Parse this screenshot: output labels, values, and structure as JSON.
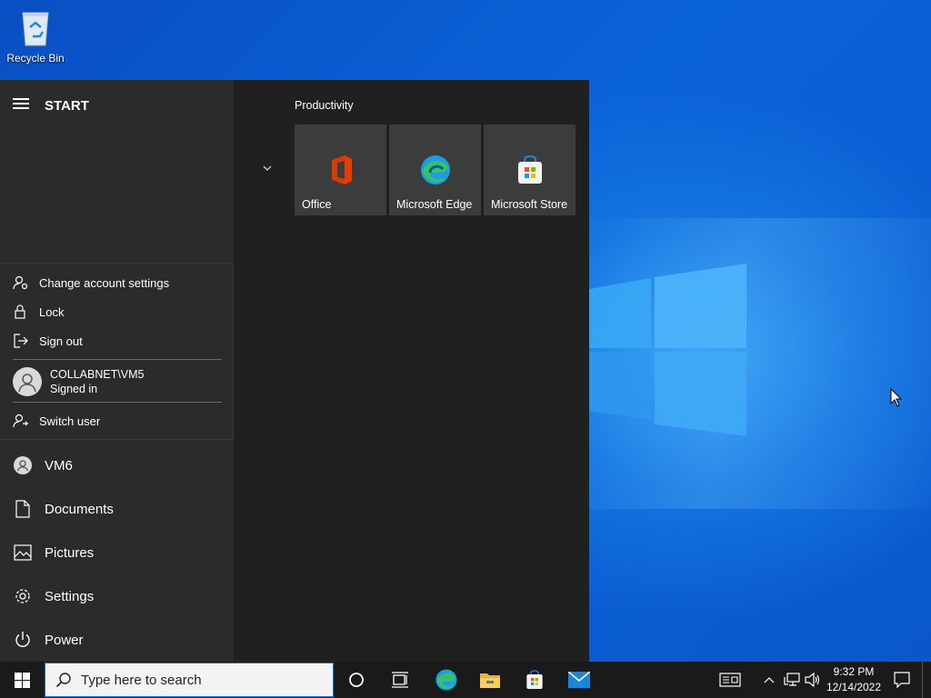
{
  "desktop": {
    "recycle_bin_label": "Recycle Bin"
  },
  "start_menu": {
    "title": "START",
    "account_flyout": {
      "items": [
        {
          "label": "Change account settings",
          "icon": "account-settings-icon"
        },
        {
          "label": "Lock",
          "icon": "lock-icon"
        },
        {
          "label": "Sign out",
          "icon": "sign-out-icon"
        }
      ],
      "current_user": {
        "name": "COLLABNET\\VM5",
        "status": "Signed in"
      },
      "switch_user_label": "Switch user"
    },
    "rail": [
      {
        "label": "VM6",
        "icon": "user-avatar-icon"
      },
      {
        "label": "Documents",
        "icon": "document-icon"
      },
      {
        "label": "Pictures",
        "icon": "pictures-icon"
      },
      {
        "label": "Settings",
        "icon": "gear-icon"
      },
      {
        "label": "Power",
        "icon": "power-icon"
      }
    ],
    "group_label": "Productivity",
    "tiles": [
      {
        "label": "Office",
        "icon": "office-icon"
      },
      {
        "label": "Microsoft Edge",
        "icon": "edge-icon"
      },
      {
        "label": "Microsoft Store",
        "icon": "store-icon"
      }
    ]
  },
  "taskbar": {
    "search_placeholder": "Type here to search",
    "pinned": [
      "cortana-icon",
      "task-view-icon",
      "edge-icon",
      "file-explorer-icon",
      "store-icon",
      "mail-icon"
    ],
    "tray": [
      "news-icon",
      "chevron-up-icon",
      "network-icon",
      "volume-icon"
    ],
    "time": "9:32 PM",
    "date": "12/14/2022"
  },
  "colors": {
    "accent": "#0078d7",
    "start_bg": "#202020",
    "rail_bg": "#2b2b2b",
    "tile_bg": "#3c3c3c",
    "taskbar_bg": "#1a1a1a"
  }
}
